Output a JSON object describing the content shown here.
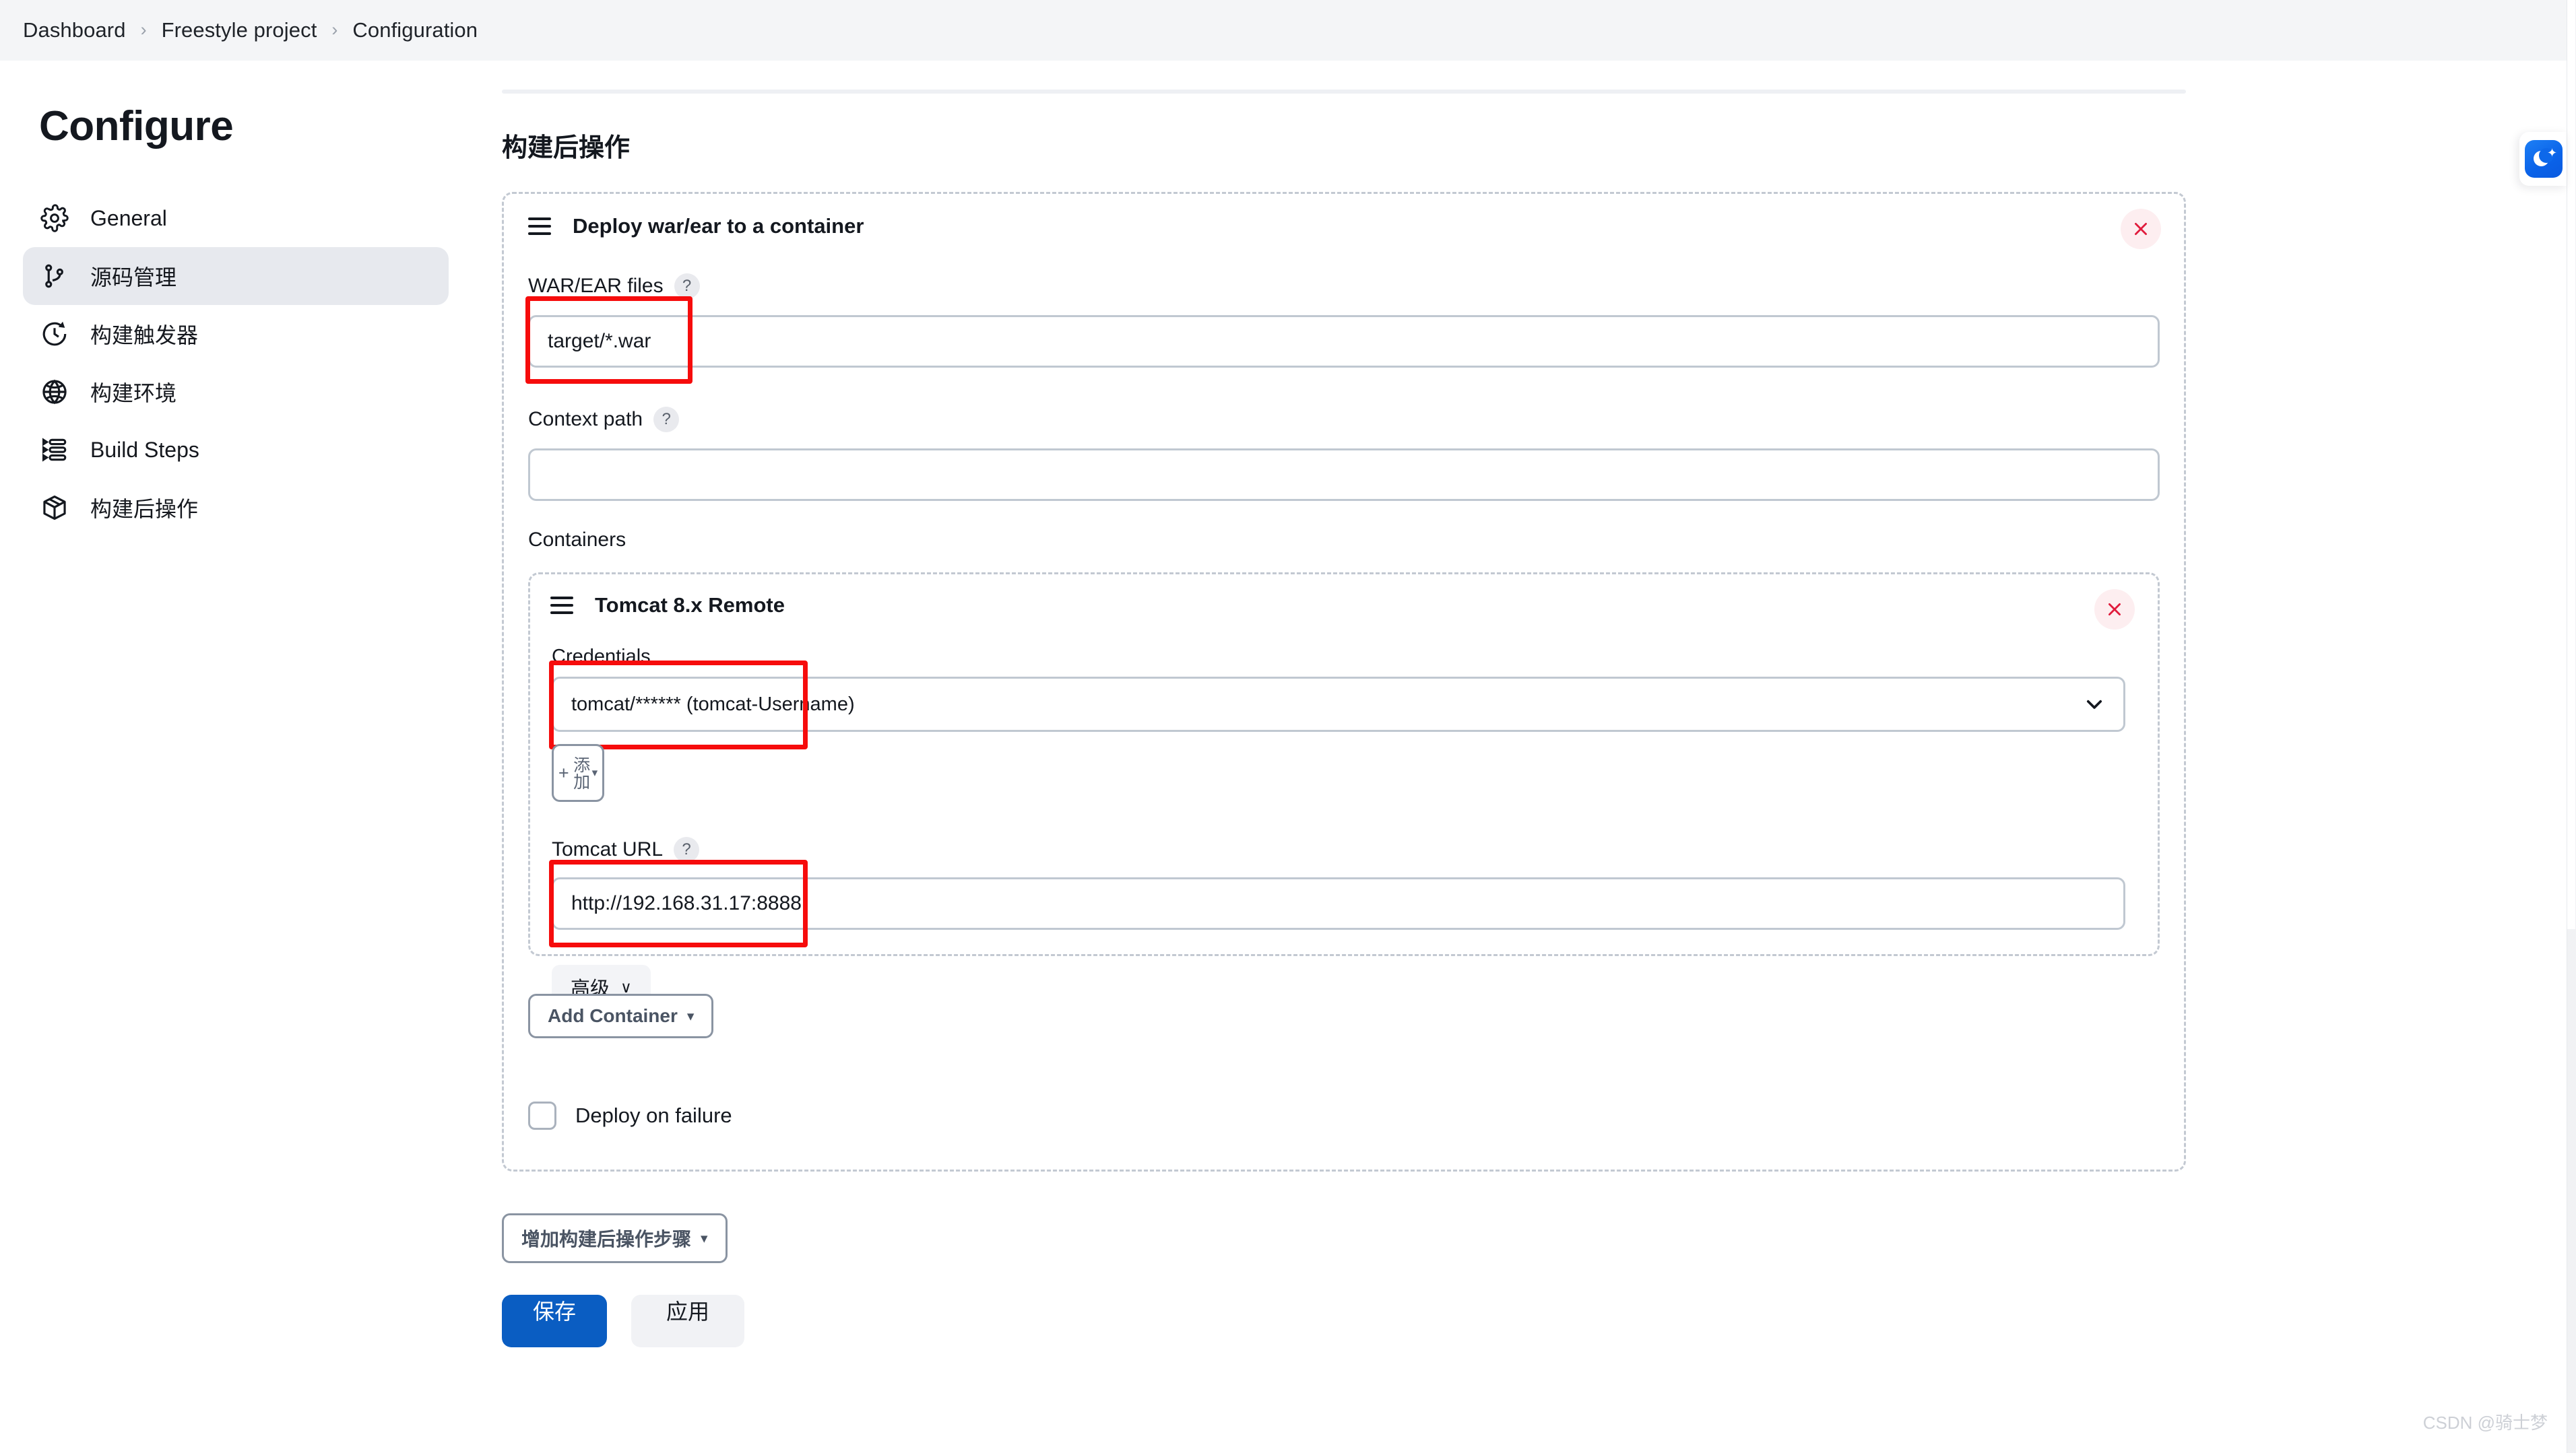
{
  "breadcrumb": {
    "items": [
      "Dashboard",
      "Freestyle project",
      "Configuration"
    ],
    "separator": "›"
  },
  "sidebar": {
    "title": "Configure",
    "items": [
      {
        "label": "General",
        "icon": "gear-icon",
        "active": false
      },
      {
        "label": "源码管理",
        "icon": "source-branch-icon",
        "active": true
      },
      {
        "label": "构建触发器",
        "icon": "clock-icon",
        "active": false
      },
      {
        "label": "构建环境",
        "icon": "globe-icon",
        "active": false
      },
      {
        "label": "Build Steps",
        "icon": "list-steps-icon",
        "active": false
      },
      {
        "label": "构建后操作",
        "icon": "package-icon",
        "active": false
      }
    ]
  },
  "main": {
    "section_title": "构建后操作",
    "publisher": {
      "title": "Deploy war/ear to a container",
      "drag_handle": "drag-handle-icon",
      "delete_icon": "close-icon",
      "war_files": {
        "label": "WAR/EAR files",
        "help": "?",
        "value": "target/*.war",
        "placeholder": ""
      },
      "context_path": {
        "label": "Context path",
        "help": "?",
        "value": "",
        "placeholder": ""
      },
      "containers_label": "Containers",
      "container": {
        "title": "Tomcat 8.x Remote",
        "drag_handle": "drag-handle-icon",
        "delete_icon": "close-icon",
        "credentials": {
          "label": "Credentials",
          "value": "tomcat/****** (tomcat-Username)",
          "chevron": "chevron-down-icon"
        },
        "add_credentials_button": {
          "plus": "+",
          "label": "添加",
          "caret": "▾"
        },
        "tomcat_url": {
          "label": "Tomcat URL",
          "help": "?",
          "value": "http://192.168.31.17:8888",
          "placeholder": ""
        },
        "advanced_button": {
          "label": "高级",
          "caret": "∨"
        }
      },
      "add_container_button": {
        "label": "Add Container",
        "caret": "▾"
      },
      "deploy_on_failure": {
        "label": "Deploy on failure",
        "checked": false
      }
    },
    "add_post_build_button": {
      "label": "增加构建后操作步骤",
      "caret": "▾"
    },
    "save_button": "保存",
    "apply_button": "应用"
  },
  "theme_toggle": {
    "icon": "dark-mode-moon-icon",
    "accent": "#0d68ea"
  },
  "watermark": "CSDN @骑士梦",
  "colors": {
    "topbar_bg": "#f4f5f7",
    "sidebar_active_bg": "#e7e9ee",
    "dashed_border": "#c3c9d2",
    "input_border": "#c0c8d1",
    "annotation_red": "#f60c0c",
    "primary_blue": "#0a5dc2"
  }
}
